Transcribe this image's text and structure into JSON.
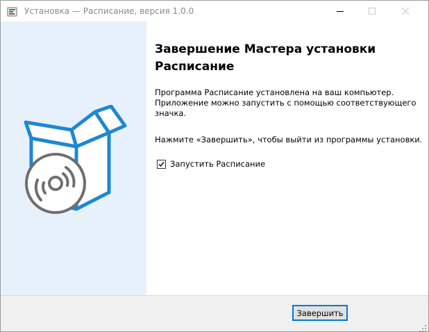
{
  "window": {
    "title": "Установка — Расписание, версия 1.0.0",
    "app_icon": "installer-app-icon",
    "controls": {
      "minimize_icon": "minimize-icon",
      "maximize_icon": "maximize-icon",
      "close_icon": "close-icon"
    }
  },
  "left_panel": {
    "illustration": "software-box-disc-icon",
    "background_color": "#e6f1fb",
    "accent_color": "#1e88d2"
  },
  "content": {
    "heading_lines": [
      "Завершение Мастера установки",
      "Расписание"
    ],
    "paragraph1_lines": [
      "Программа Расписание установлена на ваш компьютер.",
      "Приложение можно запустить с помощью соответствующего",
      "значка."
    ],
    "paragraph2_lines": [
      "Нажмите «Завершить», чтобы выйти из программы установки."
    ],
    "launch_checkbox": {
      "label": "Запустить Расписание",
      "checked": true
    }
  },
  "footer": {
    "finish_label": "Завершить",
    "accent_color": "#0078d7"
  }
}
